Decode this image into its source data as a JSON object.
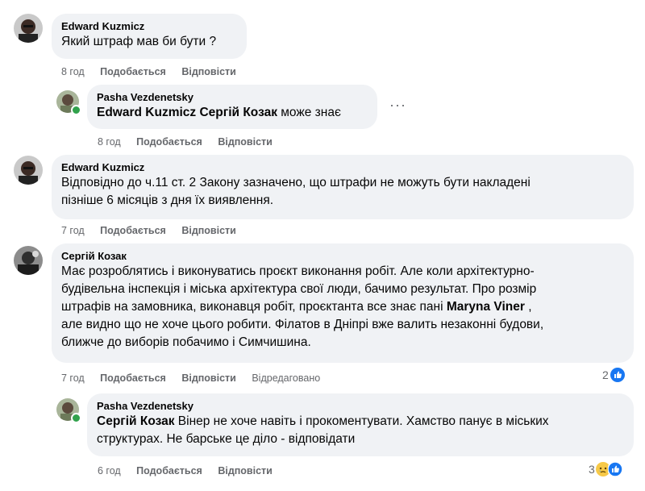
{
  "comments": [
    {
      "author": "Edward Kuzmicz",
      "text": "Який штраф мав би бути ?",
      "time": "8 год",
      "like": "Подобається",
      "reply": "Відповісти"
    },
    {
      "author": "Pasha Vezdenetsky",
      "mention": "Edward Kuzmicz Сергій Козак",
      "text": " може знає",
      "time": "8 год",
      "like": "Подобається",
      "reply": "Відповісти",
      "more": "···"
    },
    {
      "author": "Edward Kuzmicz",
      "lines": [
        "Відповідно до ч.11 ст. 2 Закону зазначено, що штрафи не можуть бути накладені",
        "пізніше 6 місяців з дня їх виявлення."
      ],
      "time": "7 год",
      "like": "Подобається",
      "reply": "Відповісти"
    },
    {
      "author": "Сергій Козак",
      "lines": [
        "Має розроблятись і виконуватись проєкт виконання робіт. Але коли архітектурно-",
        "будівельна інспекція і міська архітектура свої люди, бачимо результат. Про розмір",
        "штрафів на замовника, виконавця робіт, проєктанта все знає пані ",
        "але видно що не хоче цього робити. Філатов в Дніпрі вже валить незаконні будови,",
        "ближче до виборів побачимо і Симчишина."
      ],
      "mention": "Maryna Viner",
      "line3_after": " ,",
      "time": "7 год",
      "like": "Подобається",
      "reply": "Відповісти",
      "edited": "Відредаговано",
      "reactions": "2",
      "reaction_icon": "like-icon"
    },
    {
      "author": "Pasha Vezdenetsky",
      "mention": "Сергій Козак",
      "line1_after": " Вінер не хоче навіть і прокоментувати. Хамство панує в міських",
      "line2": "структурах. Не барське це діло - відповідати",
      "time": "6 год",
      "like": "Подобається",
      "reply": "Відповісти",
      "reactions": "3",
      "reaction_icon": "like-sad-icons"
    }
  ]
}
